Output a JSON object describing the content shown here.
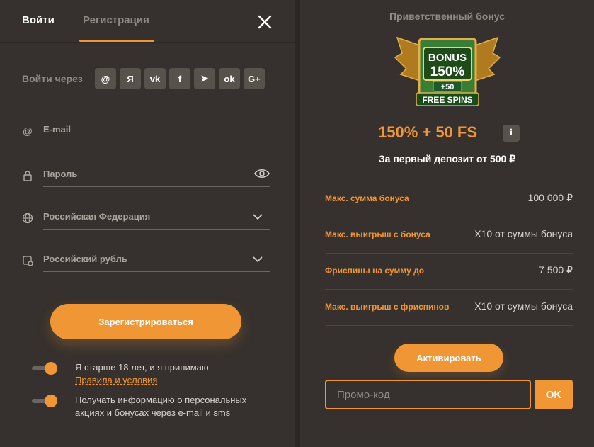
{
  "tabs": {
    "login": "Войти",
    "register": "Регистрация"
  },
  "social": {
    "label": "Войти через",
    "items": [
      {
        "name": "email",
        "glyph": "@"
      },
      {
        "name": "yandex",
        "glyph": "Я"
      },
      {
        "name": "vk",
        "glyph": "vk"
      },
      {
        "name": "facebook",
        "glyph": "f"
      },
      {
        "name": "telegram",
        "glyph": "➤"
      },
      {
        "name": "odnoklassniki",
        "glyph": "ok"
      },
      {
        "name": "google-plus",
        "glyph": "G+"
      }
    ]
  },
  "form": {
    "email_placeholder": "E-mail",
    "password_placeholder": "Пароль",
    "country_value": "Российская Федерация",
    "currency_value": "Российский рубль"
  },
  "register_button": "Зарегистрироваться",
  "consents": {
    "age_text": "Я старше 18 лет, и я принимаю",
    "rules_link": "Правила и условия",
    "promo_text": "Получать информацию о персональных акциях и бонусах через e-mail и sms"
  },
  "bonus": {
    "title": "Приветственный бонус",
    "image_text": {
      "bonus": "BONUS",
      "percent": "150%",
      "spins_count": "+50",
      "spins": "FREE SPINS"
    },
    "headline": "150% + 50 FS",
    "info_label": "i",
    "subtitle": "За первый депозит от 500 ₽",
    "rows": [
      {
        "label": "Макс. сумма бонуса",
        "value": "100 000 ₽"
      },
      {
        "label": "Макс. выигрыш с бонуса",
        "value": "X10 от суммы бонуса"
      },
      {
        "label": "Фриспины на сумму до",
        "value": "7 500 ₽"
      },
      {
        "label": "Макс. выигрыш с фриспинов",
        "value": "X10 от суммы бонуса"
      }
    ],
    "activate_button": "Активировать",
    "promo_placeholder": "Промо-код",
    "ok_button": "OK"
  },
  "colors": {
    "accent": "#f19634",
    "panel": "#36312e",
    "background": "#2a2724"
  }
}
